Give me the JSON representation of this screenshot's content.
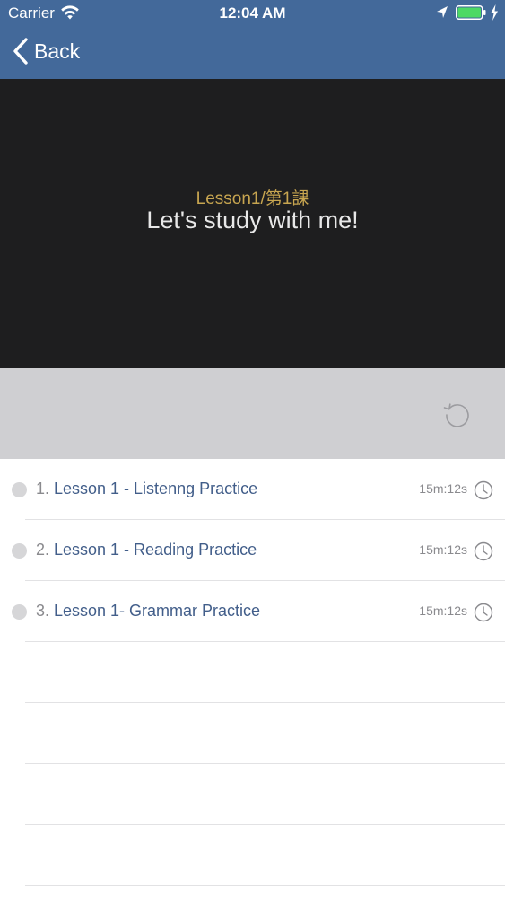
{
  "status_bar": {
    "carrier": "Carrier",
    "time": "12:04 AM",
    "icons": [
      "wifi-icon",
      "location-icon",
      "battery-icon",
      "charging-icon"
    ],
    "battery_color": "#4cd964"
  },
  "nav": {
    "back_label": "Back",
    "background": "#43699a"
  },
  "video": {
    "subtitle": "Lesson1/第1課",
    "title": "Let's study with me!",
    "subtitle_color": "#c7a550"
  },
  "controls": {
    "replay_icon": "replay-icon"
  },
  "lessons": [
    {
      "number": "1.",
      "title": "Lesson 1 - Listenng Practice",
      "duration": "15m:12s"
    },
    {
      "number": "2.",
      "title": "Lesson 1 - Reading Practice",
      "duration": "15m:12s"
    },
    {
      "number": "3.",
      "title": "Lesson 1- Grammar Practice",
      "duration": "15m:12s"
    }
  ],
  "colors": {
    "title_text": "#425e8a",
    "secondary_text": "#8a8a8e"
  }
}
